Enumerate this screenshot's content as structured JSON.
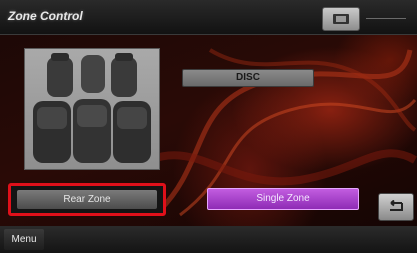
{
  "window": {
    "title": "Zone Control"
  },
  "source": {
    "label": "DISC"
  },
  "zones": {
    "rear_label": "Rear Zone",
    "single_label": "Single Zone",
    "active": "Single Zone"
  },
  "footer": {
    "menu_label": "Menu"
  },
  "icons": {
    "top_button": "speaker-icon",
    "return_button": "return-icon"
  },
  "colors": {
    "highlight_border": "#e0101a",
    "single_zone_accent": "#a23fcf",
    "background_accent": "#8e2010"
  }
}
